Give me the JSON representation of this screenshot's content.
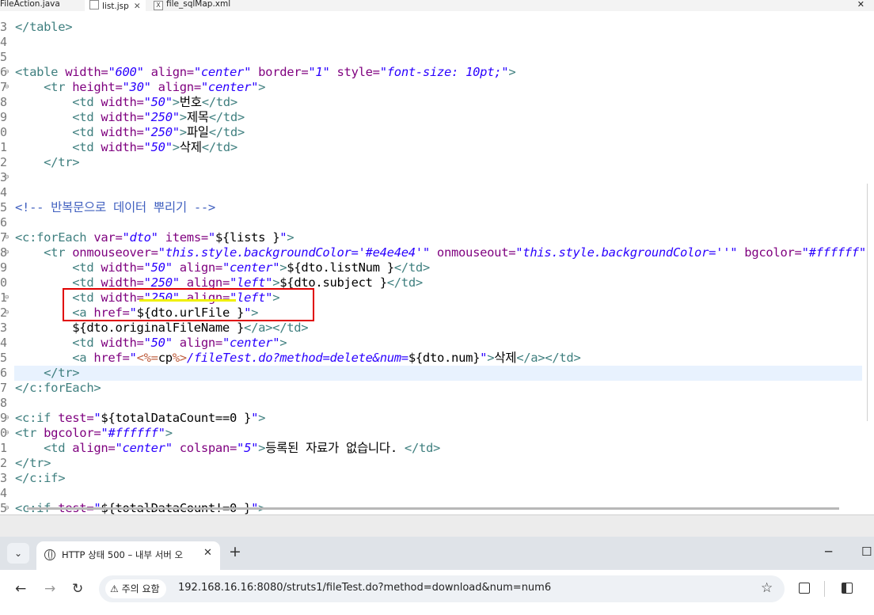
{
  "editor_tabs": [
    {
      "label": "FileAction.java",
      "icon": "java-file-icon"
    },
    {
      "label": "list.jsp",
      "icon": "jsp-file-icon"
    },
    {
      "label": "file_sqlMap.xml",
      "icon": "xml-file-icon"
    }
  ],
  "close_glyph": "✕",
  "editor": {
    "current_line_index": 23,
    "lines": [
      {
        "num": "3",
        "fold": "",
        "segments": [
          {
            "t": "</table>",
            "c": "tg"
          }
        ]
      },
      {
        "num": "4",
        "fold": "",
        "segments": []
      },
      {
        "num": "5",
        "fold": "",
        "segments": []
      },
      {
        "num": "6",
        "fold": "⊖",
        "segments": [
          {
            "t": "<table ",
            "c": "tg"
          },
          {
            "t": "width=",
            "c": "an"
          },
          {
            "t": "\"600\"",
            "c": "av"
          },
          {
            "t": " align=",
            "c": "an"
          },
          {
            "t": "\"center\"",
            "c": "av"
          },
          {
            "t": " border=",
            "c": "an"
          },
          {
            "t": "\"1\"",
            "c": "av"
          },
          {
            "t": " style=",
            "c": "an"
          },
          {
            "t": "\"font-size: ",
            "c": "av"
          },
          {
            "t": "10pt",
            "c": "av"
          },
          {
            "t": ";\"",
            "c": "av"
          },
          {
            "t": ">",
            "c": "tg"
          }
        ]
      },
      {
        "num": "7",
        "fold": "⊖",
        "segments": [
          {
            "t": "    <tr ",
            "c": "tg"
          },
          {
            "t": "height=",
            "c": "an"
          },
          {
            "t": "\"30\"",
            "c": "av"
          },
          {
            "t": " align=",
            "c": "an"
          },
          {
            "t": "\"center\"",
            "c": "av"
          },
          {
            "t": ">",
            "c": "tg"
          }
        ]
      },
      {
        "num": "8",
        "fold": "",
        "segments": [
          {
            "t": "        <td ",
            "c": "tg"
          },
          {
            "t": "width=",
            "c": "an"
          },
          {
            "t": "\"50\"",
            "c": "av"
          },
          {
            "t": ">",
            "c": "tg"
          },
          {
            "t": "번호",
            "c": "el"
          },
          {
            "t": "</td>",
            "c": "tg"
          }
        ]
      },
      {
        "num": "9",
        "fold": "",
        "segments": [
          {
            "t": "        <td ",
            "c": "tg"
          },
          {
            "t": "width=",
            "c": "an"
          },
          {
            "t": "\"250\"",
            "c": "av"
          },
          {
            "t": ">",
            "c": "tg"
          },
          {
            "t": "제목",
            "c": "el"
          },
          {
            "t": "</td>",
            "c": "tg"
          }
        ]
      },
      {
        "num": "0",
        "fold": "",
        "segments": [
          {
            "t": "        <td ",
            "c": "tg"
          },
          {
            "t": "width=",
            "c": "an"
          },
          {
            "t": "\"250\"",
            "c": "av"
          },
          {
            "t": ">",
            "c": "tg"
          },
          {
            "t": "파일",
            "c": "el"
          },
          {
            "t": "</td>",
            "c": "tg"
          }
        ]
      },
      {
        "num": "1",
        "fold": "",
        "segments": [
          {
            "t": "        <td ",
            "c": "tg"
          },
          {
            "t": "width=",
            "c": "an"
          },
          {
            "t": "\"50\"",
            "c": "av"
          },
          {
            "t": ">",
            "c": "tg"
          },
          {
            "t": "삭제",
            "c": "el"
          },
          {
            "t": "</td>",
            "c": "tg"
          }
        ]
      },
      {
        "num": "2",
        "fold": "",
        "segments": [
          {
            "t": "    </tr>",
            "c": "tg"
          }
        ]
      },
      {
        "num": "3",
        "fold": "⊖",
        "segments": []
      },
      {
        "num": "4",
        "fold": "",
        "segments": []
      },
      {
        "num": "5",
        "fold": "",
        "segments": [
          {
            "t": "<!-- 반복문으로 데이터 뿌리기 -->",
            "c": "cm"
          }
        ]
      },
      {
        "num": "6",
        "fold": "",
        "segments": []
      },
      {
        "num": "7",
        "fold": "⊖",
        "segments": [
          {
            "t": "<c:forEach ",
            "c": "tg"
          },
          {
            "t": "var=",
            "c": "an"
          },
          {
            "t": "\"dto\"",
            "c": "av"
          },
          {
            "t": " items=",
            "c": "an"
          },
          {
            "t": "\"",
            "c": "av"
          },
          {
            "t": "${lists }",
            "c": "el"
          },
          {
            "t": "\"",
            "c": "av"
          },
          {
            "t": ">",
            "c": "tg"
          }
        ]
      },
      {
        "num": "8",
        "fold": "⊖",
        "segments": [
          {
            "t": "    <tr ",
            "c": "tg"
          },
          {
            "t": "onmouseover=",
            "c": "an"
          },
          {
            "t": "\"this.style.backgroundColor='#e4e4e4'\"",
            "c": "av"
          },
          {
            "t": " onmouseout=",
            "c": "an"
          },
          {
            "t": "\"this.style.backgroundColor=''\"",
            "c": "av"
          },
          {
            "t": " bgcolor=",
            "c": "an"
          },
          {
            "t": "\"#ffffff\"",
            "c": "av"
          }
        ]
      },
      {
        "num": "9",
        "fold": "",
        "segments": [
          {
            "t": "        <td ",
            "c": "tg"
          },
          {
            "t": "width=",
            "c": "an"
          },
          {
            "t": "\"50\"",
            "c": "av"
          },
          {
            "t": " align=",
            "c": "an"
          },
          {
            "t": "\"center\"",
            "c": "av"
          },
          {
            "t": ">",
            "c": "tg"
          },
          {
            "t": "${dto.listNum }",
            "c": "el"
          },
          {
            "t": "</td>",
            "c": "tg"
          }
        ]
      },
      {
        "num": "0",
        "fold": "",
        "segments": [
          {
            "t": "        <td ",
            "c": "tg"
          },
          {
            "t": "width=",
            "c": "an"
          },
          {
            "t": "\"250\"",
            "c": "av"
          },
          {
            "t": " align=",
            "c": "an"
          },
          {
            "t": "\"left\"",
            "c": "av"
          },
          {
            "t": ">",
            "c": "tg"
          },
          {
            "t": "${dto.subject }",
            "c": "el"
          },
          {
            "t": "</td>",
            "c": "tg"
          }
        ]
      },
      {
        "num": "1",
        "fold": "⊖",
        "segments": [
          {
            "t": "        <td ",
            "c": "tg"
          },
          {
            "t": "width=",
            "c": "an"
          },
          {
            "t": "\"250\"",
            "c": "av"
          },
          {
            "t": " align=",
            "c": "an"
          },
          {
            "t": "\"left\"",
            "c": "av"
          },
          {
            "t": ">",
            "c": "tg"
          }
        ]
      },
      {
        "num": "2",
        "fold": "⊖",
        "segments": [
          {
            "t": "        <a ",
            "c": "tg"
          },
          {
            "t": "href=",
            "c": "an"
          },
          {
            "t": "\"",
            "c": "av"
          },
          {
            "t": "${dto.urlFile }",
            "c": "el"
          },
          {
            "t": "\"",
            "c": "av"
          },
          {
            "t": ">",
            "c": "tg"
          }
        ]
      },
      {
        "num": "3",
        "fold": "",
        "segments": [
          {
            "t": "        ${dto.originalFileName }",
            "c": "el"
          },
          {
            "t": "</a></td>",
            "c": "tg"
          }
        ]
      },
      {
        "num": "4",
        "fold": "",
        "segments": [
          {
            "t": "        <td ",
            "c": "tg"
          },
          {
            "t": "width=",
            "c": "an"
          },
          {
            "t": "\"50\"",
            "c": "av"
          },
          {
            "t": " align=",
            "c": "an"
          },
          {
            "t": "\"center\"",
            "c": "av"
          },
          {
            "t": ">",
            "c": "tg"
          }
        ]
      },
      {
        "num": "5",
        "fold": "",
        "segments": [
          {
            "t": "        <a ",
            "c": "tg"
          },
          {
            "t": "href=",
            "c": "an"
          },
          {
            "t": "\"",
            "c": "av"
          },
          {
            "t": "<%=",
            "c": "jsp"
          },
          {
            "t": "cp",
            "c": "el"
          },
          {
            "t": "%>",
            "c": "jsp"
          },
          {
            "t": "/fileTest.do?method=delete&num=",
            "c": "av"
          },
          {
            "t": "${dto.num}",
            "c": "el"
          },
          {
            "t": "\"",
            "c": "av"
          },
          {
            "t": ">",
            "c": "tg"
          },
          {
            "t": "삭제",
            "c": "el"
          },
          {
            "t": "</a></td>",
            "c": "tg"
          }
        ]
      },
      {
        "num": "6",
        "fold": "",
        "segments": [
          {
            "t": "    </tr>",
            "c": "tg"
          }
        ]
      },
      {
        "num": "7",
        "fold": "",
        "segments": [
          {
            "t": "</c:forEach>",
            "c": "tg"
          }
        ]
      },
      {
        "num": "8",
        "fold": "",
        "segments": []
      },
      {
        "num": "9",
        "fold": "⊖",
        "segments": [
          {
            "t": "<c:if ",
            "c": "tg"
          },
          {
            "t": "test=",
            "c": "an"
          },
          {
            "t": "\"",
            "c": "av"
          },
          {
            "t": "${totalDataCount==0 }",
            "c": "el"
          },
          {
            "t": "\"",
            "c": "av"
          },
          {
            "t": ">",
            "c": "tg"
          }
        ]
      },
      {
        "num": "0",
        "fold": "⊖",
        "segments": [
          {
            "t": "<tr ",
            "c": "tg"
          },
          {
            "t": "bgcolor=",
            "c": "an"
          },
          {
            "t": "\"#ffffff\"",
            "c": "av"
          },
          {
            "t": ">",
            "c": "tg"
          }
        ]
      },
      {
        "num": "1",
        "fold": "",
        "segments": [
          {
            "t": "    <td ",
            "c": "tg"
          },
          {
            "t": "align=",
            "c": "an"
          },
          {
            "t": "\"center\"",
            "c": "av"
          },
          {
            "t": " colspan=",
            "c": "an"
          },
          {
            "t": "\"5\"",
            "c": "av"
          },
          {
            "t": ">",
            "c": "tg"
          },
          {
            "t": "등록된 자료가 없습니다. ",
            "c": "el"
          },
          {
            "t": "</td>",
            "c": "tg"
          }
        ]
      },
      {
        "num": "2",
        "fold": "",
        "segments": [
          {
            "t": "</tr>",
            "c": "tg"
          }
        ]
      },
      {
        "num": "3",
        "fold": "",
        "segments": [
          {
            "t": "</c:if>",
            "c": "tg"
          }
        ]
      },
      {
        "num": "4",
        "fold": "",
        "segments": []
      },
      {
        "num": "5",
        "fold": "⊖",
        "segments": [
          {
            "t": "<c:if ",
            "c": "tg"
          },
          {
            "t": "test=",
            "c": "an"
          },
          {
            "t": "\"",
            "c": "av"
          },
          {
            "t": "${totalDataCount!=0 }",
            "c": "el"
          },
          {
            "t": "\"",
            "c": "av"
          },
          {
            "t": ">",
            "c": "tg"
          }
        ]
      }
    ]
  },
  "browser": {
    "tab_title": "HTTP 상태 500 – 내부 서버 오",
    "tab_close": "✕",
    "new_tab": "+",
    "dropdown_glyph": "⌄",
    "security_label": "주의 요함",
    "url": "192.168.16.16:8080/struts1/fileTest.do?method=download&num=num6",
    "back_glyph": "←",
    "forward_glyph": "→",
    "reload_glyph": "↻",
    "star_glyph": "☆",
    "warn_glyph": "⚠",
    "minimize_glyph": "─",
    "maximize_glyph": "☐"
  },
  "colors": {
    "tag": "#3f7f7f",
    "attribute": "#7f007f",
    "value": "#2a00ff",
    "comment": "#3f5fbf",
    "highlight_box": "#e00000"
  }
}
